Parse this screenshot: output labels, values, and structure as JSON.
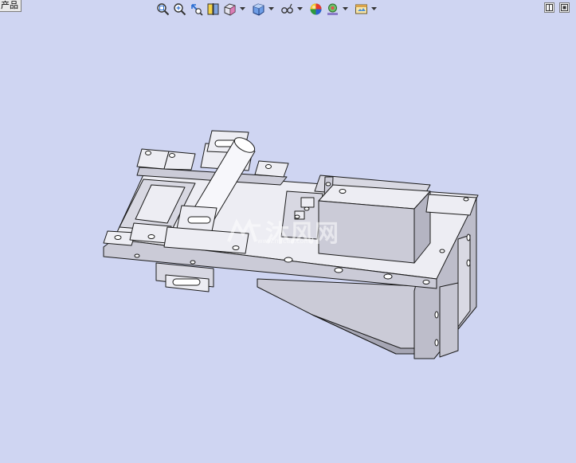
{
  "tab": {
    "label": "产品"
  },
  "toolbar": {
    "tools": [
      {
        "id": "zoom-to-fit",
        "icon": "zoom-fit-icon"
      },
      {
        "id": "zoom-to-area",
        "icon": "zoom-area-icon"
      },
      {
        "id": "previous-view",
        "icon": "previous-view-icon"
      },
      {
        "id": "section-view",
        "icon": "section-view-icon"
      },
      {
        "id": "view-orientation",
        "icon": "view-orientation-icon",
        "dropdown": true
      },
      {
        "id": "display-style",
        "icon": "display-style-icon",
        "dropdown": true
      },
      {
        "id": "hide-show-items",
        "icon": "hide-show-icon",
        "dropdown": true
      },
      {
        "id": "edit-appearance",
        "icon": "appearance-icon"
      },
      {
        "id": "apply-scene",
        "icon": "scene-icon",
        "dropdown": true
      },
      {
        "id": "view-settings",
        "icon": "view-settings-icon",
        "dropdown": true
      }
    ]
  },
  "viewport_controls": [
    "restore-pane-icon",
    "close-pane-icon"
  ],
  "watermark": {
    "text": "沐风网",
    "url": "www.mfcad.com"
  },
  "colors": {
    "background": "#cfd5f2",
    "part_face_light": "#ededf3",
    "part_face_mid": "#cbcbd7",
    "part_face_dark": "#a6a6b4",
    "edge": "#1a1a1a"
  }
}
